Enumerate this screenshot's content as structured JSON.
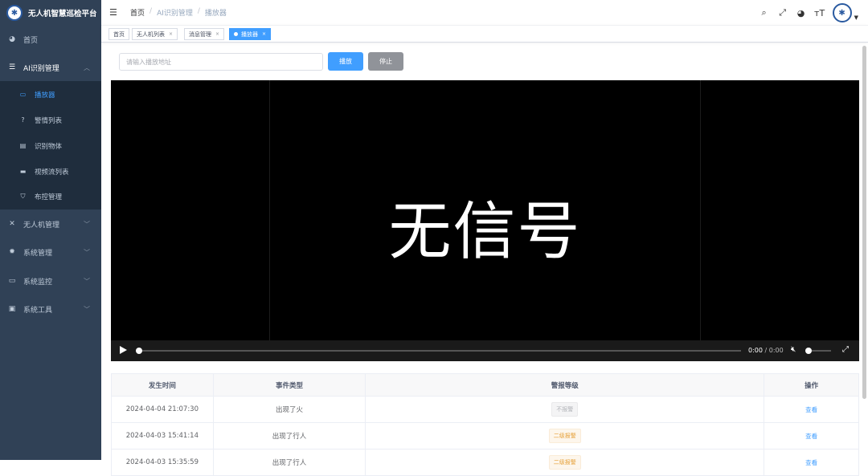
{
  "app": {
    "title": "无人机智慧巡检平台"
  },
  "sidebar": {
    "items": [
      {
        "label": "首页",
        "icon": "dashboard-icon"
      },
      {
        "label": "AI识别管理",
        "icon": "list-icon",
        "expanded": true
      },
      {
        "label": "无人机管理",
        "icon": "drone-icon"
      },
      {
        "label": "系统管理",
        "icon": "gear-icon"
      },
      {
        "label": "系统监控",
        "icon": "monitor-icon"
      },
      {
        "label": "系统工具",
        "icon": "toolbox-icon"
      }
    ],
    "subitems": [
      {
        "label": "播放器",
        "icon": "monitor-icon",
        "active": true
      },
      {
        "label": "警情列表",
        "icon": "question-circle-icon"
      },
      {
        "label": "识别物体",
        "icon": "document-icon"
      },
      {
        "label": "视频流列表",
        "icon": "video-icon"
      },
      {
        "label": "布控管理",
        "icon": "shield-icon"
      }
    ]
  },
  "breadcrumb": {
    "home": "首页",
    "level1": "AI识别管理",
    "current": "播放器"
  },
  "tags": [
    {
      "label": "首页"
    },
    {
      "label": "无人机列表"
    },
    {
      "label": "消息管理"
    },
    {
      "label": "播放器",
      "active": true
    }
  ],
  "controls": {
    "url_placeholder": "请输入播放地址",
    "url_value": "",
    "play_label": "播放",
    "stop_label": "停止"
  },
  "video": {
    "overlay_text": "无信号",
    "current_time": "0:00",
    "duration": "0:00"
  },
  "table": {
    "headers": [
      "发生时间",
      "事件类型",
      "警报等级",
      "操作"
    ],
    "rows": [
      {
        "time": "2024-04-04 21:07:30",
        "type": "出现了火",
        "level": "不报警",
        "level_style": "none",
        "action": "查看"
      },
      {
        "time": "2024-04-03 15:41:14",
        "type": "出现了行人",
        "level": "二级报警",
        "level_style": "warn",
        "action": "查看"
      },
      {
        "time": "2024-04-03 15:35:59",
        "type": "出现了行人",
        "level": "二级报警",
        "level_style": "warn",
        "action": "查看"
      }
    ]
  },
  "colors": {
    "sidebar_bg": "#304156",
    "submenu_bg": "#1f2d3d",
    "primary": "#409eff",
    "info": "#909399",
    "warning": "#e6a23c"
  }
}
